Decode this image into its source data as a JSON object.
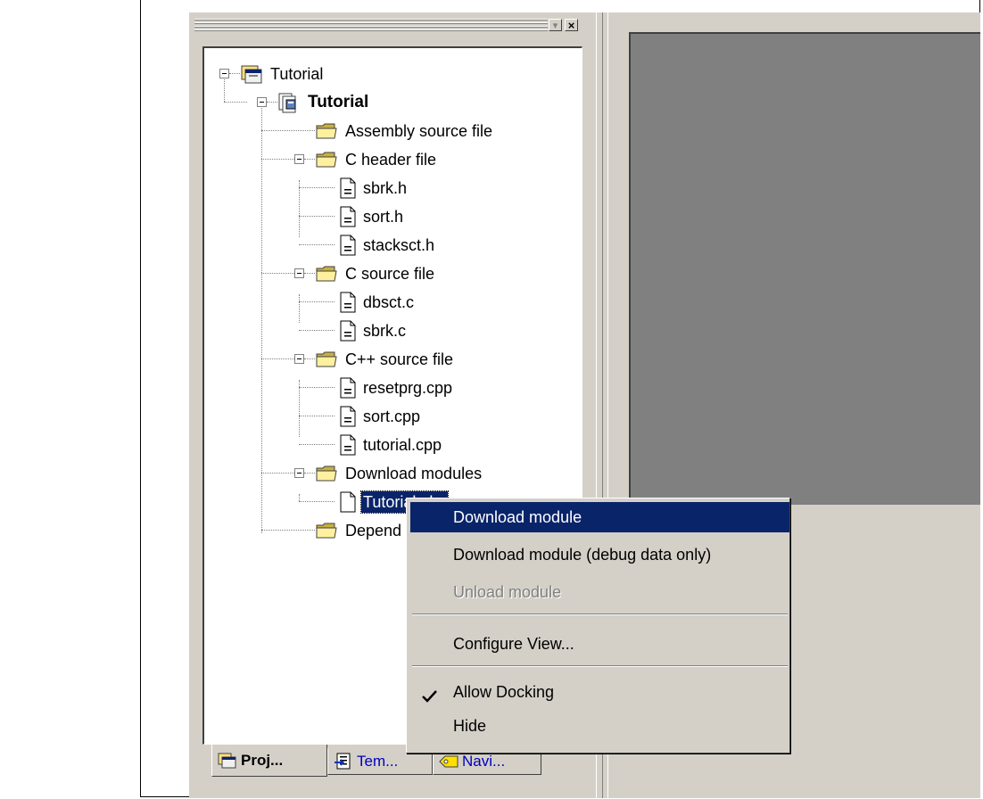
{
  "panel": {
    "title_buttons": {
      "menu": "▾",
      "close": "×"
    },
    "tree": {
      "root": {
        "label": "Tutorial"
      },
      "project": {
        "label": "Tutorial"
      },
      "folders": [
        {
          "label": "Assembly source file",
          "files": []
        },
        {
          "label": "C header file",
          "files": [
            "sbrk.h",
            "sort.h",
            "stacksct.h"
          ]
        },
        {
          "label": "C source file",
          "files": [
            "dbsct.c",
            "sbrk.c"
          ]
        },
        {
          "label": "C++ source file",
          "files": [
            "resetprg.cpp",
            "sort.cpp",
            "tutorial.cpp"
          ]
        },
        {
          "label": "Download modules",
          "files": [
            "Tutorial.abs"
          ]
        },
        {
          "label": "Depend",
          "files": []
        }
      ],
      "selected_file": "Tutorial.abs"
    },
    "tabs": [
      {
        "label": "Proj...",
        "icon": "project-tab-icon",
        "active": true
      },
      {
        "label": "Tem...",
        "icon": "templates-tab-icon",
        "active": false
      },
      {
        "label": "Navi...",
        "icon": "navigation-tab-icon",
        "active": false
      }
    ]
  },
  "context_menu": {
    "items": [
      {
        "label": "Download module",
        "highlighted": true,
        "disabled": false
      },
      {
        "label": "Download module (debug data only)",
        "highlighted": false,
        "disabled": false
      },
      {
        "label": "Unload module",
        "highlighted": false,
        "disabled": true
      },
      {
        "label": "Configure View...",
        "highlighted": false,
        "disabled": false
      },
      {
        "label": "Allow Docking",
        "checked": true,
        "highlighted": false,
        "disabled": false
      },
      {
        "label": "Hide",
        "highlighted": false,
        "disabled": false
      }
    ]
  },
  "colors": {
    "highlight": "#0a246a",
    "face": "#d4d0c8",
    "workspace": "#808080"
  }
}
